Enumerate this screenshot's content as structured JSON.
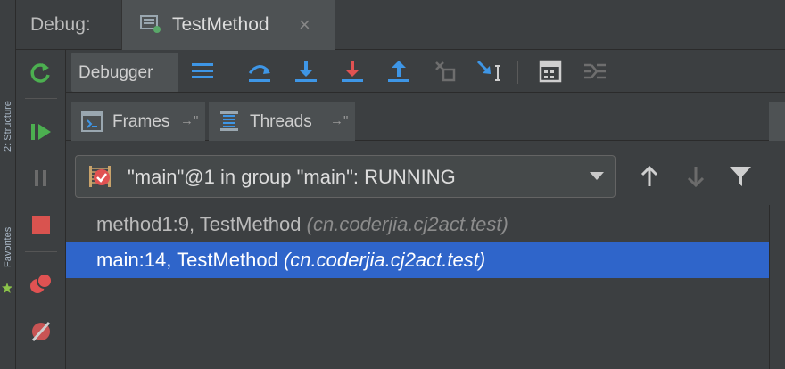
{
  "window": {
    "debug_label": "Debug:",
    "run_tab_label": "TestMethod",
    "run_tab_close": "×"
  },
  "side_strip": {
    "top_label": "2: Structure",
    "bottom_label": "Favorites"
  },
  "left_toolbar": {
    "icons": [
      "rerun-icon",
      "resume-icon",
      "pause-icon",
      "stop-icon",
      "view-breakpoints-icon",
      "mute-breakpoints-icon"
    ]
  },
  "debugger_toolbar": {
    "debugger_tab_label": "Debugger",
    "icons": [
      "show-execution-point-icon",
      "step-over-icon",
      "step-into-icon",
      "force-step-into-icon",
      "step-out-icon",
      "drop-frame-icon",
      "run-to-cursor-icon",
      "evaluate-expression-icon",
      "trace-current-stream-icon"
    ]
  },
  "panel_tabs": {
    "frames_label": "Frames",
    "frames_pin": "→\"",
    "threads_label": "Threads",
    "threads_pin": "→\""
  },
  "thread_selector": {
    "value": "\"main\"@1 in group \"main\": RUNNING"
  },
  "frames": [
    {
      "name": "method1:9, TestMethod",
      "package": "(cn.coderjia.cj2act.test)",
      "selected": false
    },
    {
      "name": "main:14, TestMethod",
      "package": "(cn.coderjia.cj2act.test)",
      "selected": true
    }
  ],
  "colors": {
    "background": "#3c3f41",
    "selection": "#2f65ca",
    "step_blue": "#3e96e6",
    "step_red": "#e05252",
    "resume_green": "#4caf50",
    "stop_red": "#d9534f"
  }
}
